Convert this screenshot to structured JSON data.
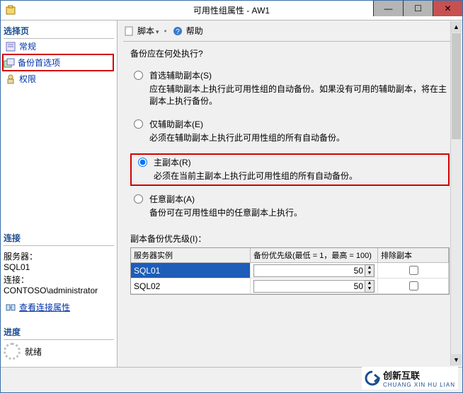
{
  "window": {
    "title": "可用性组属性 - AW1"
  },
  "left": {
    "select_header": "选择页",
    "nav": [
      {
        "label": "常规"
      },
      {
        "label": "备份首选项"
      },
      {
        "label": "权限"
      }
    ],
    "conn_header": "连接",
    "server_label": "服务器：",
    "server_value": "SQL01",
    "conn_label": "连接：",
    "conn_value": "CONTOSO\\administrator",
    "view_conn_link": "查看连接属性",
    "progress_header": "进度",
    "status": "就绪"
  },
  "toolbar": {
    "script_label": "脚本",
    "help_label": "帮助"
  },
  "form": {
    "question": "备份应在何处执行?",
    "opt1": {
      "label": "首选辅助副本(S)",
      "desc": "应在辅助副本上执行此可用性组的自动备份。如果没有可用的辅助副本，将在主副本上执行备份。"
    },
    "opt2": {
      "label": "仅辅助副本(E)",
      "desc": "必须在辅助副本上执行此可用性组的所有自动备份。"
    },
    "opt3": {
      "label": "主副本(R)",
      "desc": "必须在当前主副本上执行此可用性组的所有自动备份。"
    },
    "opt4": {
      "label": "任意副本(A)",
      "desc": "备份可在可用性组中的任意副本上执行。"
    },
    "prio_label": "副本备份优先级(I)：",
    "grid": {
      "col_server": "服务器实例",
      "col_priority": "备份优先级(最低 = 1，最高 = 100)",
      "col_exclude": "排除副本",
      "rows": [
        {
          "name": "SQL01",
          "priority": "50"
        },
        {
          "name": "SQL02",
          "priority": "50"
        }
      ]
    }
  },
  "watermark": {
    "brand": "创新互联",
    "sub": "CHUANG XIN HU LIAN"
  }
}
